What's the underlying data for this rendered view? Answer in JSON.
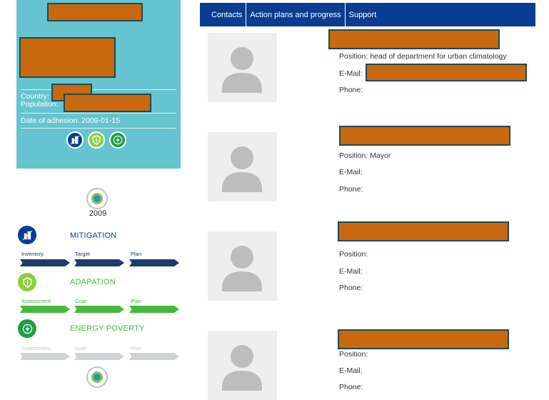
{
  "sidebar": {
    "card": {
      "country_label": "Country:",
      "population_label": "Population:",
      "adhesion_text": "Date of adhesion: 2009-01-15",
      "pillar_badges": [
        {
          "icon": "mitigation-icon",
          "color": "#0a3d91"
        },
        {
          "icon": "adaptation-icon",
          "color": "#46b83c"
        },
        {
          "icon": "energy-poverty-icon",
          "color": "#1f9e4a"
        }
      ]
    },
    "year": "2009",
    "pillars": [
      {
        "title": "MITIGATION",
        "icon": "mitigation-icon",
        "color": "#0a3d91",
        "stages": [
          "Inventory",
          "Target",
          "Plan"
        ],
        "stage_color": "#1d3c6e",
        "label_color": "#1d3c6e"
      },
      {
        "title": "ADAPATION",
        "icon": "adaptation-icon",
        "color": "#46b83c",
        "stages": [
          "Assessment",
          "Goal",
          "Plan"
        ],
        "stage_color": "#46b83c",
        "label_color": "#46b83c"
      },
      {
        "title": "ENERGY POVERTY",
        "icon": "energy-poverty-icon",
        "color": "#1f9e4a",
        "stages": [
          "Assessment",
          "Goal",
          "Plan"
        ],
        "stage_color": "#cfd3d6",
        "label_color": "#c4c8cb"
      }
    ]
  },
  "nav": {
    "tabs": [
      "Contacts",
      "Action plans and progress",
      "Support"
    ],
    "background": "#0a3d91"
  },
  "contacts": [
    {
      "position_label": "Position: head of department for urban climatology",
      "email_label": "E-Mail:",
      "phone_label": "Phone:"
    },
    {
      "position_label": "Position: Mayor",
      "email_label": "E-Mail:",
      "phone_label": "Phone:"
    },
    {
      "position_label": "Position:",
      "email_label": "E-Mail:",
      "phone_label": "Phone:"
    },
    {
      "position_label": "Position:",
      "email_label": "E-Mail:",
      "phone_label": "Phone:"
    }
  ],
  "redaction_color": "#c9690f"
}
